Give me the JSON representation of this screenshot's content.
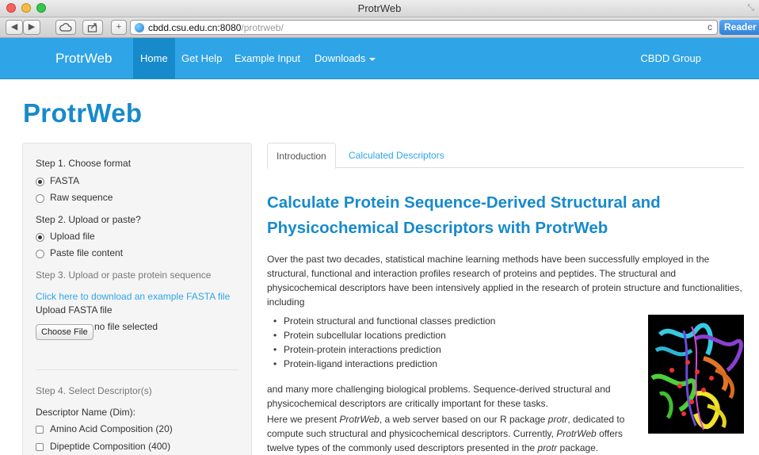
{
  "window": {
    "title": "ProtrWeb"
  },
  "browser": {
    "url_host": "cbdd.csu.edu.cn:8080",
    "url_path": "/protrweb/",
    "reader_label": "Reader",
    "back_glyph": "◀",
    "forward_glyph": "▶",
    "add_glyph": "+",
    "reload_glyph": "c"
  },
  "navbar": {
    "brand": "ProtrWeb",
    "items": [
      "Home",
      "Get Help",
      "Example Input",
      "Downloads"
    ],
    "right": "CBDD Group",
    "colors": {
      "bar": "#2fa4e7",
      "active": "#178acc"
    }
  },
  "page": {
    "title": "ProtrWeb"
  },
  "sidebar": {
    "step1": "Step 1. Choose format",
    "format_options": [
      {
        "label": "FASTA",
        "checked": true
      },
      {
        "label": "Raw sequence",
        "checked": false
      }
    ],
    "step2": "Step 2. Upload or paste?",
    "upload_options": [
      {
        "label": "Upload file",
        "checked": true
      },
      {
        "label": "Paste file content",
        "checked": false
      }
    ],
    "step3": "Step 3. Upload or paste protein sequence",
    "example_link": "Click here to download an example FASTA file",
    "upload_label": "Upload FASTA file",
    "choose_file": "Choose File",
    "file_status": "no file selected",
    "step4": "Step 4. Select Descriptor(s)",
    "descriptor_header": "Descriptor Name (Dim):",
    "descriptors": [
      {
        "label": "Amino Acid Composition (20)",
        "checked": false
      },
      {
        "label": "Dipeptide Composition (400)",
        "checked": false
      }
    ]
  },
  "main": {
    "tabs": [
      "Introduction",
      "Calculated Descriptors"
    ],
    "active_tab": "Introduction",
    "headline": "Calculate Protein Sequence-Derived Structural and Physicochemical Descriptors with ProtrWeb",
    "intro": "Over the past two decades, statistical machine learning methods have been successfully employed in the structural, functional and interaction profiles research of proteins and peptides. The structural and physicochemical descriptors have been intensively applied in the research of protein structure and functionalities, including",
    "bullets": [
      "Protein structural and functional classes prediction",
      "Protein subcellular locations prediction",
      "Protein-protein interactions prediction",
      "Protein-ligand interactions prediction"
    ],
    "para2": "and many more challenging biological problems. Sequence-derived structural and physicochemical descriptors are critically important for these tasks.",
    "para3": {
      "p1": "Here we present ",
      "em1": "ProtrWeb",
      "p2": ", a web server based on our R package ",
      "em2": "protr",
      "p3": ", dedicated to compute such structural and physicochemical descriptors. Currently, ",
      "em3": "ProtrWeb",
      "p4": " offers twelve types of the commonly used descriptors presented in the ",
      "em4": "protr",
      "p5": " package."
    }
  }
}
